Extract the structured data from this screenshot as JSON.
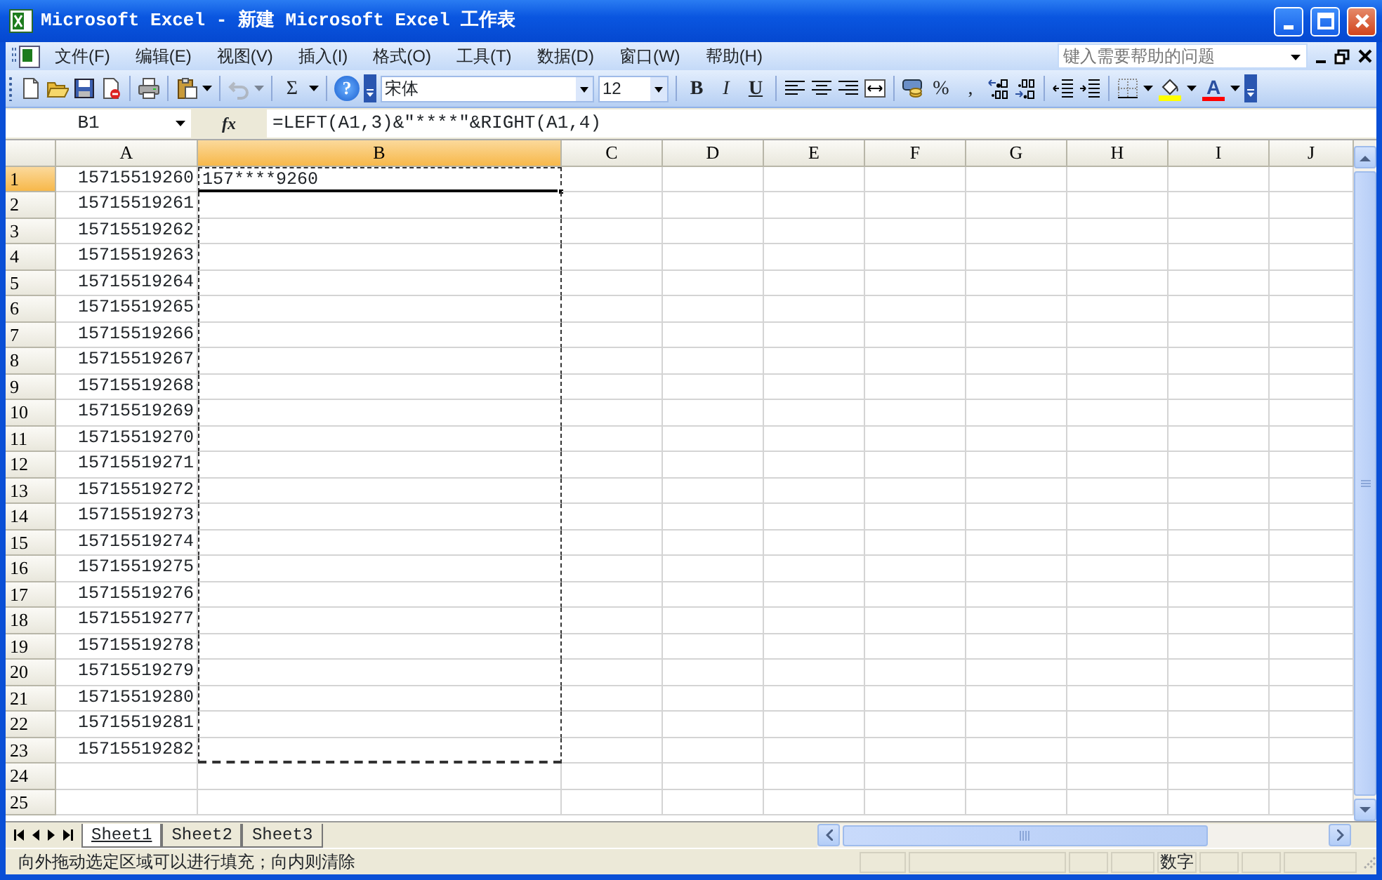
{
  "window": {
    "title": "Microsoft Excel - 新建 Microsoft Excel 工作表"
  },
  "menu": [
    {
      "label": "文件(F)"
    },
    {
      "label": "编辑(E)"
    },
    {
      "label": "视图(V)"
    },
    {
      "label": "插入(I)"
    },
    {
      "label": "格式(O)"
    },
    {
      "label": "工具(T)"
    },
    {
      "label": "数据(D)"
    },
    {
      "label": "窗口(W)"
    },
    {
      "label": "帮助(H)"
    }
  ],
  "help_box": {
    "placeholder": "键入需要帮助的问题"
  },
  "toolbar": [
    {
      "kind": "new"
    },
    {
      "kind": "open"
    },
    {
      "kind": "save"
    },
    {
      "kind": "permission"
    },
    {
      "kind": "separator"
    },
    {
      "kind": "print"
    },
    {
      "kind": "separator"
    },
    {
      "kind": "paste",
      "has_menu": true
    },
    {
      "kind": "separator"
    },
    {
      "kind": "undo",
      "disabled": true,
      "has_menu": true
    },
    {
      "kind": "separator"
    },
    {
      "kind": "text",
      "label": "Σ",
      "has_menu": true
    },
    {
      "kind": "separator"
    },
    {
      "kind": "help",
      "label": "?"
    },
    {
      "kind": "options"
    },
    {
      "kind": "font",
      "value": "宋体"
    },
    {
      "kind": "size",
      "value": "12"
    },
    {
      "kind": "separator"
    },
    {
      "kind": "bold",
      "label": "B"
    },
    {
      "kind": "italic",
      "label": "I"
    },
    {
      "kind": "underline",
      "label": "U"
    },
    {
      "kind": "separator"
    },
    {
      "kind": "align-left"
    },
    {
      "kind": "align-center"
    },
    {
      "kind": "align-right"
    },
    {
      "kind": "merge"
    },
    {
      "kind": "separator"
    },
    {
      "kind": "currency"
    },
    {
      "kind": "text",
      "label": "%"
    },
    {
      "kind": "text",
      "label": ","
    },
    {
      "kind": "increase-decimal"
    },
    {
      "kind": "decrease-decimal"
    },
    {
      "kind": "separator"
    },
    {
      "kind": "outdent"
    },
    {
      "kind": "indent"
    },
    {
      "kind": "separator"
    },
    {
      "kind": "borders",
      "has_menu": true
    },
    {
      "kind": "fill-color",
      "color": "#ffff00",
      "has_menu": true
    },
    {
      "kind": "font-color",
      "label": "A",
      "color": "#ff0000",
      "has_menu": true
    },
    {
      "kind": "options"
    }
  ],
  "formula_bar": {
    "name_box": "B1",
    "fx": "fx",
    "formula": "=LEFT(A1,3)&\"****\"&RIGHT(A1,4)"
  },
  "columns": [
    {
      "label": "A",
      "selected": false
    },
    {
      "label": "B",
      "selected": true
    },
    {
      "label": "C",
      "selected": false
    },
    {
      "label": "D",
      "selected": false
    },
    {
      "label": "E",
      "selected": false
    },
    {
      "label": "F",
      "selected": false
    },
    {
      "label": "G",
      "selected": false
    },
    {
      "label": "H",
      "selected": false
    },
    {
      "label": "I",
      "selected": false
    },
    {
      "label": "J",
      "selected": false
    }
  ],
  "rows": [
    {
      "label": "1",
      "selected": true,
      "in_fill_range": true,
      "cells": [
        {
          "text": "15715519260",
          "kind": "number"
        },
        {
          "text": "157****9260",
          "kind": "text"
        }
      ]
    },
    {
      "label": "2",
      "selected": false,
      "in_fill_range": true,
      "cells": [
        {
          "text": "15715519261",
          "kind": "number"
        }
      ]
    },
    {
      "label": "3",
      "selected": false,
      "in_fill_range": true,
      "cells": [
        {
          "text": "15715519262",
          "kind": "number"
        }
      ]
    },
    {
      "label": "4",
      "selected": false,
      "in_fill_range": true,
      "cells": [
        {
          "text": "15715519263",
          "kind": "number"
        }
      ]
    },
    {
      "label": "5",
      "selected": false,
      "in_fill_range": true,
      "cells": [
        {
          "text": "15715519264",
          "kind": "number"
        }
      ]
    },
    {
      "label": "6",
      "selected": false,
      "in_fill_range": true,
      "cells": [
        {
          "text": "15715519265",
          "kind": "number"
        }
      ]
    },
    {
      "label": "7",
      "selected": false,
      "in_fill_range": true,
      "cells": [
        {
          "text": "15715519266",
          "kind": "number"
        }
      ]
    },
    {
      "label": "8",
      "selected": false,
      "in_fill_range": true,
      "cells": [
        {
          "text": "15715519267",
          "kind": "number"
        }
      ]
    },
    {
      "label": "9",
      "selected": false,
      "in_fill_range": true,
      "cells": [
        {
          "text": "15715519268",
          "kind": "number"
        }
      ]
    },
    {
      "label": "10",
      "selected": false,
      "in_fill_range": true,
      "cells": [
        {
          "text": "15715519269",
          "kind": "number"
        }
      ]
    },
    {
      "label": "11",
      "selected": false,
      "in_fill_range": true,
      "cells": [
        {
          "text": "15715519270",
          "kind": "number"
        }
      ]
    },
    {
      "label": "12",
      "selected": false,
      "in_fill_range": true,
      "cells": [
        {
          "text": "15715519271",
          "kind": "number"
        }
      ]
    },
    {
      "label": "13",
      "selected": false,
      "in_fill_range": true,
      "cells": [
        {
          "text": "15715519272",
          "kind": "number"
        }
      ]
    },
    {
      "label": "14",
      "selected": false,
      "in_fill_range": true,
      "cells": [
        {
          "text": "15715519273",
          "kind": "number"
        }
      ]
    },
    {
      "label": "15",
      "selected": false,
      "in_fill_range": true,
      "cells": [
        {
          "text": "15715519274",
          "kind": "number"
        }
      ]
    },
    {
      "label": "16",
      "selected": false,
      "in_fill_range": true,
      "cells": [
        {
          "text": "15715519275",
          "kind": "number"
        }
      ]
    },
    {
      "label": "17",
      "selected": false,
      "in_fill_range": true,
      "cells": [
        {
          "text": "15715519276",
          "kind": "number"
        }
      ]
    },
    {
      "label": "18",
      "selected": false,
      "in_fill_range": true,
      "cells": [
        {
          "text": "15715519277",
          "kind": "number"
        }
      ]
    },
    {
      "label": "19",
      "selected": false,
      "in_fill_range": true,
      "cells": [
        {
          "text": "15715519278",
          "kind": "number"
        }
      ]
    },
    {
      "label": "20",
      "selected": false,
      "in_fill_range": true,
      "cells": [
        {
          "text": "15715519279",
          "kind": "number"
        }
      ]
    },
    {
      "label": "21",
      "selected": false,
      "in_fill_range": true,
      "cells": [
        {
          "text": "15715519280",
          "kind": "number"
        }
      ]
    },
    {
      "label": "22",
      "selected": false,
      "in_fill_range": true,
      "cells": [
        {
          "text": "15715519281",
          "kind": "number"
        }
      ]
    },
    {
      "label": "23",
      "selected": false,
      "in_fill_range": true,
      "cells": [
        {
          "text": "15715519282",
          "kind": "number"
        }
      ]
    },
    {
      "label": "24",
      "selected": false,
      "in_fill_range": false,
      "cells": []
    },
    {
      "label": "25",
      "selected": false,
      "in_fill_range": false,
      "cells": []
    }
  ],
  "sheet_tabs": [
    {
      "label": "Sheet1",
      "selected": true
    },
    {
      "label": "Sheet2",
      "selected": false
    },
    {
      "label": "Sheet3",
      "selected": false
    }
  ],
  "status_bar": {
    "message": "向外拖动选定区域可以进行填充；向内则清除",
    "num_lock": "数字"
  }
}
